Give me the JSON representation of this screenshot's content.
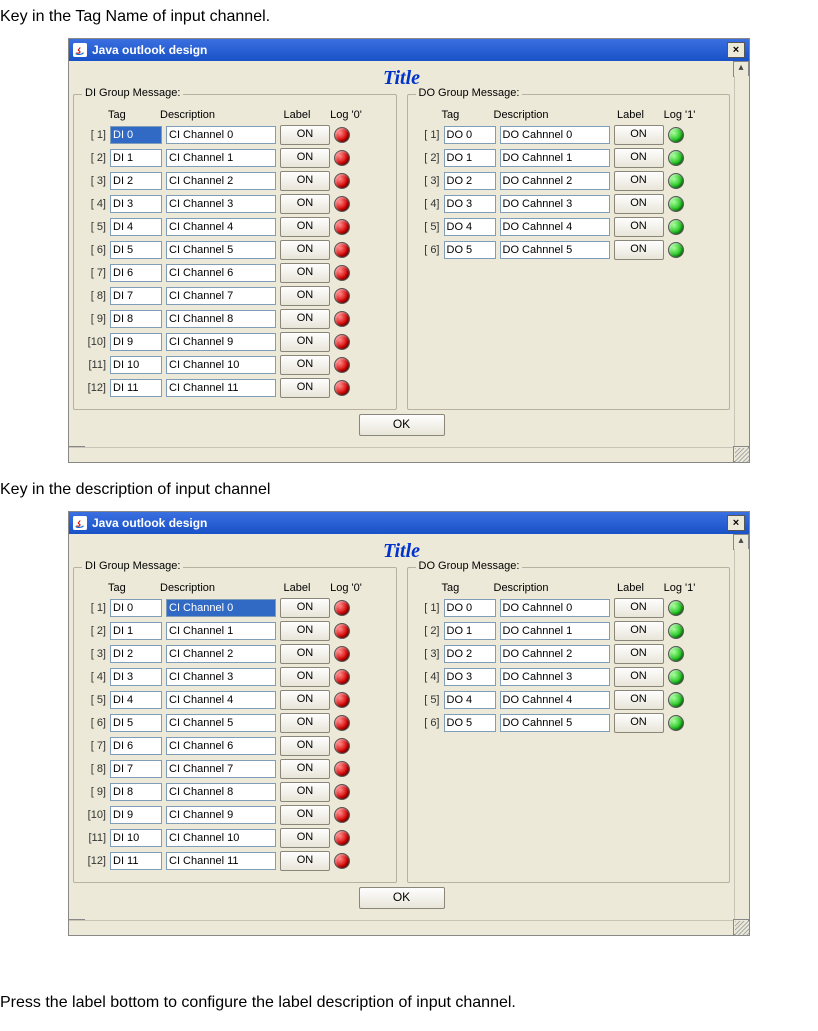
{
  "captions": {
    "top": "Key in the Tag Name of input channel.",
    "mid": "Key in the description of input channel",
    "bottom": "Press the label bottom to configure the label description of input channel."
  },
  "window": {
    "title": "Java outlook design",
    "app_title": "Title",
    "ok_label": "OK"
  },
  "di_group": {
    "title": "DI Group Message:",
    "headers": {
      "tag": "Tag",
      "desc": "Description",
      "label": "Label",
      "log": "Log '0'"
    },
    "rows": [
      {
        "idx": "[ 1]",
        "tag": "DI 0",
        "desc": "CI Channel 0",
        "label": "ON"
      },
      {
        "idx": "[ 2]",
        "tag": "DI 1",
        "desc": "CI Channel 1",
        "label": "ON"
      },
      {
        "idx": "[ 3]",
        "tag": "DI 2",
        "desc": "CI Channel 2",
        "label": "ON"
      },
      {
        "idx": "[ 4]",
        "tag": "DI 3",
        "desc": "CI Channel 3",
        "label": "ON"
      },
      {
        "idx": "[ 5]",
        "tag": "DI 4",
        "desc": "CI Channel 4",
        "label": "ON"
      },
      {
        "idx": "[ 6]",
        "tag": "DI 5",
        "desc": "CI Channel 5",
        "label": "ON"
      },
      {
        "idx": "[ 7]",
        "tag": "DI 6",
        "desc": "CI Channel 6",
        "label": "ON"
      },
      {
        "idx": "[ 8]",
        "tag": "DI 7",
        "desc": "CI Channel 7",
        "label": "ON"
      },
      {
        "idx": "[ 9]",
        "tag": "DI 8",
        "desc": "CI Channel 8",
        "label": "ON"
      },
      {
        "idx": "[10]",
        "tag": "DI 9",
        "desc": "CI Channel 9",
        "label": "ON"
      },
      {
        "idx": "[11]",
        "tag": "DI 10",
        "desc": "CI Channel 10",
        "label": "ON"
      },
      {
        "idx": "[12]",
        "tag": "DI 11",
        "desc": "CI Channel 11",
        "label": "ON"
      }
    ],
    "led_color": "red"
  },
  "do_group": {
    "title": "DO Group Message:",
    "headers": {
      "tag": "Tag",
      "desc": "Description",
      "label": "Label",
      "log": "Log '1'"
    },
    "rows": [
      {
        "idx": "[ 1]",
        "tag": "DO 0",
        "desc": "DO Cahnnel 0",
        "label": "ON"
      },
      {
        "idx": "[ 2]",
        "tag": "DO 1",
        "desc": "DO Cahnnel 1",
        "label": "ON"
      },
      {
        "idx": "[ 3]",
        "tag": "DO 2",
        "desc": "DO Cahnnel 2",
        "label": "ON"
      },
      {
        "idx": "[ 4]",
        "tag": "DO 3",
        "desc": "DO Cahnnel 3",
        "label": "ON"
      },
      {
        "idx": "[ 5]",
        "tag": "DO 4",
        "desc": "DO Cahnnel 4",
        "label": "ON"
      },
      {
        "idx": "[ 6]",
        "tag": "DO 5",
        "desc": "DO Cahnnel 5",
        "label": "ON"
      }
    ],
    "led_color": "green"
  },
  "selection": {
    "first": {
      "group": "di",
      "row": 0,
      "field": "tag"
    },
    "second": {
      "group": "di",
      "row": 0,
      "field": "desc"
    }
  }
}
